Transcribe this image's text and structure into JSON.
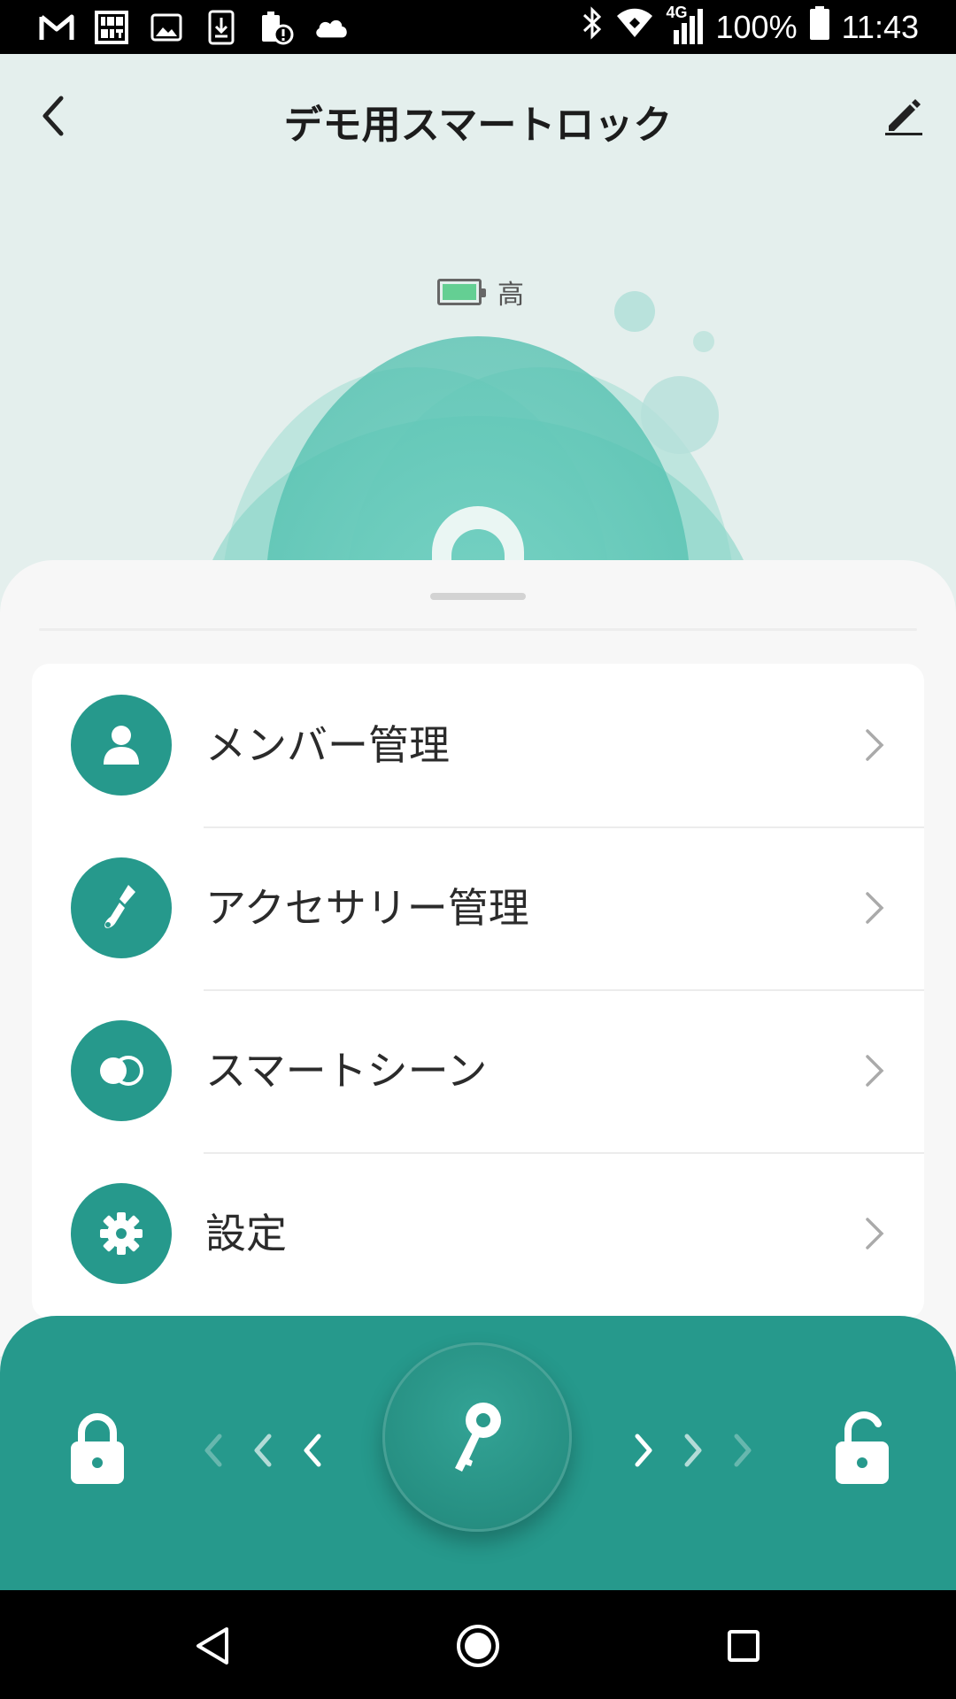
{
  "status_bar": {
    "network": "4G",
    "battery_percent": "100%",
    "time": "11:43",
    "left_icons": [
      "gmail-icon",
      "iconit-icon",
      "image-icon",
      "download-icon",
      "battery-alert-icon",
      "cloud-icon"
    ],
    "right_icons": [
      "bluetooth-icon",
      "wifi-icon",
      "signal-icon",
      "battery-icon"
    ]
  },
  "header": {
    "title": "デモ用スマートロック",
    "back_icon": "chevron-left-icon",
    "edit_icon": "pencil-icon"
  },
  "device": {
    "battery_level_label": "高",
    "battery_fill_fraction": 1.0,
    "battery_color": "#64cf93"
  },
  "menu": {
    "items": [
      {
        "label": "メンバー管理",
        "icon": "person-icon"
      },
      {
        "label": "アクセサリー管理",
        "icon": "brush-icon"
      },
      {
        "label": "スマートシーン",
        "icon": "toggle-circles-icon"
      },
      {
        "label": "設定",
        "icon": "gear-icon"
      }
    ]
  },
  "control": {
    "lock_icon": "lock-icon",
    "unlock_icon": "unlock-icon",
    "key_icon": "key-icon",
    "accent_color": "#26998c"
  },
  "nav": {
    "icons": [
      "back-triangle-icon",
      "home-circle-icon",
      "recents-square-icon"
    ]
  }
}
